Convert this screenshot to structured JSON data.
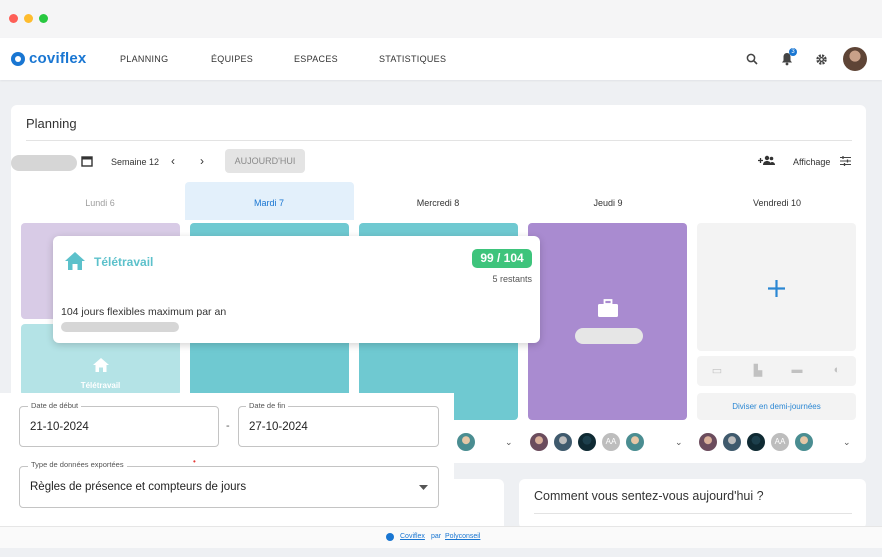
{
  "brand": {
    "name": "coviflex",
    "footer_name": "Coviflex",
    "footer_by": "par",
    "footer_company": "Polyconseil",
    "accent": "#1976d2"
  },
  "nav": {
    "items": [
      "PLANNING",
      "ÉQUIPES",
      "ESPACES",
      "STATISTIQUES"
    ],
    "notification_count": "3",
    "icons": [
      "search-icon",
      "bell-icon",
      "gear-icon"
    ]
  },
  "planning": {
    "title": "Planning",
    "week_label": "Semaine 12",
    "today_button": "AUJOURD'HUI",
    "display_label": "Affichage",
    "days": [
      {
        "label": "Lundi 6"
      },
      {
        "label": "Mardi 7"
      },
      {
        "label": "Mercredi 8"
      },
      {
        "label": "Jeudi 9"
      },
      {
        "label": "Vendredi 10"
      }
    ],
    "lundi_card_label": "Télétravail",
    "split_button": "Diviser en demi-journées",
    "avatar_initials": "AA"
  },
  "tooltip": {
    "title": "Télétravail",
    "counter": "99 / 104",
    "remaining": "5 restants",
    "description": "104 jours flexibles maximum par an"
  },
  "export": {
    "start_label": "Date de début",
    "start_value": "21-10-2024",
    "separator": "-",
    "end_label": "Date de fin",
    "end_value": "27-10-2024",
    "type_label": "Type de données exportées",
    "type_value": "Règles de présence et compteurs de jours"
  },
  "mood": {
    "question": "Comment vous sentez-vous aujourd'hui ?"
  },
  "colors": {
    "lundi_top": "#d8cbe6",
    "lundi_bottom": "#b4e3e6",
    "teal": "#6fc9d1",
    "purple": "#a98bd0",
    "counter_green": "#3ec47c",
    "empty_tile": "#f3f3f3"
  }
}
